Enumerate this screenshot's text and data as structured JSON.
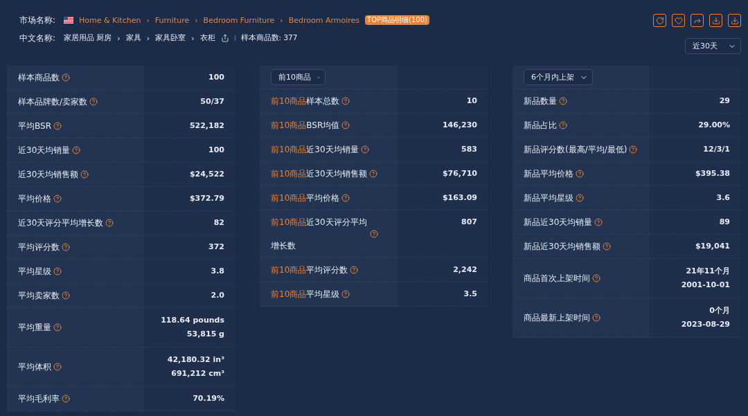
{
  "header": {
    "market_label": "市场名称:",
    "breadcrumb": [
      "Home & Kitchen",
      "Furniture",
      "Bedroom Furniture",
      "Bedroom Armoires"
    ],
    "separator": "›",
    "badge": "TOP商品明细(100)",
    "cn_label": "中文名称:",
    "cn_breadcrumb": [
      "家居用品 厨房",
      "家具",
      "家具卧室",
      "衣柜"
    ],
    "sample_count": "样本商品数: 377"
  },
  "period_select": {
    "value": "近30天"
  },
  "panels": [
    {
      "rows": [
        {
          "label": "样本商品数",
          "values": [
            "100"
          ]
        },
        {
          "label": "样本品牌数/卖家数",
          "values": [
            "50/37"
          ]
        },
        {
          "label": "平均BSR",
          "values": [
            "522,182"
          ]
        },
        {
          "label": "近30天均销量",
          "values": [
            "100"
          ]
        },
        {
          "label": "近30天均销售额",
          "values": [
            "$24,522"
          ]
        },
        {
          "label": "平均价格",
          "values": [
            "$372.79"
          ]
        },
        {
          "label": "近30天评分平均增长数",
          "values": [
            "82"
          ]
        },
        {
          "label": "平均评分数",
          "values": [
            "372"
          ]
        },
        {
          "label": "平均星级",
          "values": [
            "3.8"
          ]
        },
        {
          "label": "平均卖家数",
          "values": [
            "2.0"
          ]
        },
        {
          "label": "平均重量",
          "values": [
            "118.64 pounds",
            "53,815 g"
          ]
        },
        {
          "label": "平均体积",
          "values": [
            "42,180.32 in³",
            "691,212 cm³"
          ]
        },
        {
          "label": "平均毛利率",
          "values": [
            "70.19%"
          ]
        }
      ]
    },
    {
      "select": {
        "value": "前10商品"
      },
      "rows": [
        {
          "prefix": "前10商品",
          "label": "样本总数",
          "values": [
            "10"
          ]
        },
        {
          "prefix": "前10商品",
          "label": "BSR均值",
          "values": [
            "146,230"
          ]
        },
        {
          "prefix": "前10商品",
          "label": "近30天均销量",
          "values": [
            "583"
          ]
        },
        {
          "prefix": "前10商品",
          "label": "近30天均销售额",
          "values": [
            "$76,710"
          ]
        },
        {
          "prefix": "前10商品",
          "label": "平均价格",
          "values": [
            "$163.09"
          ]
        },
        {
          "prefix": "前10商品",
          "label": "近30天评分平均增长数",
          "values": [
            "807"
          ]
        },
        {
          "prefix": "前10商品",
          "label": "平均评分数",
          "values": [
            "2,242"
          ]
        },
        {
          "prefix": "前10商品",
          "label": "平均星级",
          "values": [
            "3.5"
          ]
        }
      ]
    },
    {
      "select": {
        "value": "6个月内上架"
      },
      "rows": [
        {
          "label": "新品数量",
          "values": [
            "29"
          ]
        },
        {
          "label": "新品占比",
          "values": [
            "29.00%"
          ]
        },
        {
          "label": "新品评分数(最高/平均/最低)",
          "values": [
            "12/3/1"
          ]
        },
        {
          "label": "新品平均价格",
          "values": [
            "$395.38"
          ]
        },
        {
          "label": "新品平均星级",
          "values": [
            "3.6"
          ]
        },
        {
          "label": "新品近30天均销量",
          "values": [
            "89"
          ]
        },
        {
          "label": "新品近30天均销售额",
          "values": [
            "$19,041"
          ]
        },
        {
          "label": "商品首次上架时间",
          "values": [
            "21年11个月",
            "2001-10-01"
          ]
        },
        {
          "label": "商品最新上架时间",
          "values": [
            "0个月",
            "2023-08-29"
          ]
        }
      ]
    }
  ]
}
